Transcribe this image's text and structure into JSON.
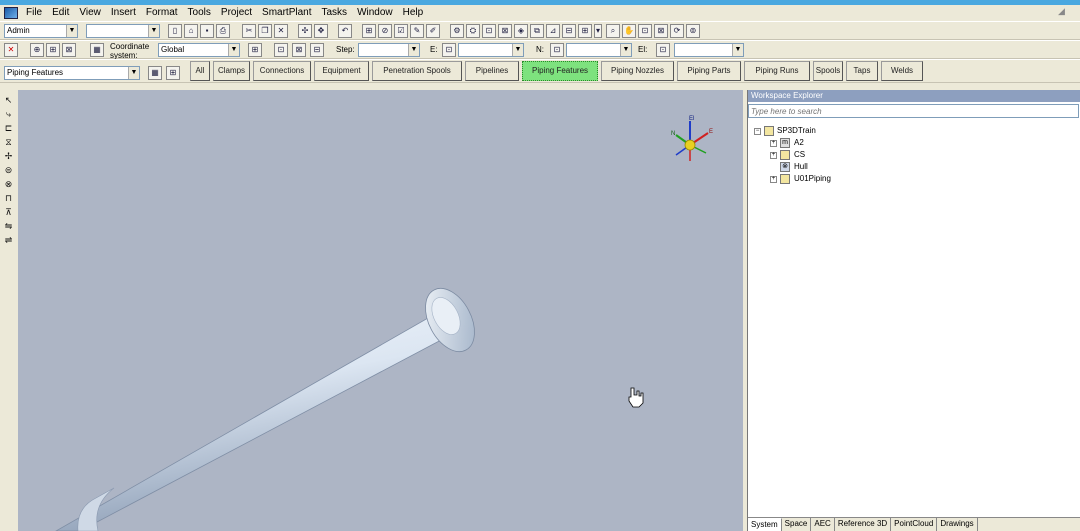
{
  "menu": [
    "File",
    "Edit",
    "View",
    "Insert",
    "Format",
    "Tools",
    "Project",
    "SmartPlant",
    "Tasks",
    "Window",
    "Help"
  ],
  "toolbar1": {
    "role_combo": "Admin",
    "empty_combo": ""
  },
  "toolbar2": {
    "coord_system_label": "Coordinate system:",
    "coord_system_value": "Global",
    "step_label": "Step:",
    "step_value": "",
    "e_label": "E:",
    "e_value": "",
    "n_label": "N:",
    "n_value": "",
    "el_label": "El:",
    "el_value": ""
  },
  "toolbar3": {
    "locate_filter": "Piping Features",
    "filter_buttons": [
      "All",
      "Clamps",
      "Connections",
      "Equipment",
      "Penetration Spools",
      "Pipelines",
      "Piping Features",
      "Piping Nozzles",
      "Piping Parts",
      "Piping Runs",
      "Spools",
      "Taps",
      "Welds"
    ],
    "active_filter": "Piping Features"
  },
  "compass": {
    "up_label": "El",
    "east_label": "E",
    "north_label": "N"
  },
  "workspace": {
    "title": "Workspace Explorer",
    "search_placeholder": "Type here to search",
    "tree": [
      {
        "label": "SP3DTrain",
        "level": 0,
        "icon": "folder-icon",
        "expanded": true
      },
      {
        "label": "A2",
        "level": 1,
        "icon": "area-icon",
        "expanded": false
      },
      {
        "label": "CS",
        "level": 1,
        "icon": "folder-icon",
        "expanded": false
      },
      {
        "label": "Hull",
        "level": 1,
        "icon": "hull-icon",
        "expanded": false
      },
      {
        "label": "U01Piping",
        "level": 1,
        "icon": "unit-icon",
        "expanded": false
      }
    ],
    "tabs": [
      "System",
      "Space",
      "AEC",
      "Reference 3D",
      "PointCloud",
      "Drawings"
    ],
    "active_tab": "System"
  },
  "colors": {
    "viewport_bg": "#adb5c5",
    "active_filter_bg": "#7ee27e",
    "title_bar": "#4aa8e0",
    "pipe": "#dce6f2"
  }
}
